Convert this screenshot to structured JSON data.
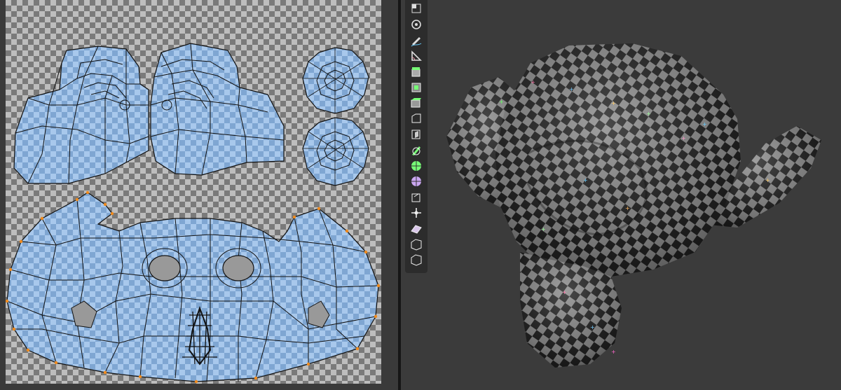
{
  "uv_editor": {
    "islands": [
      "head-left",
      "head-right",
      "ear-disc-top",
      "ear-disc-bottom",
      "face"
    ]
  },
  "viewport": {
    "object": "monkey-mesh",
    "material": "checker-texture"
  },
  "toolbar": {
    "tools": [
      {
        "name": "select-box-tool-icon",
        "active": false
      },
      {
        "name": "cursor-tool-icon",
        "active": false
      },
      {
        "name": "annotate-tool-icon",
        "active": false
      },
      {
        "name": "measure-tool-icon",
        "active": false
      },
      {
        "name": "add-cube-tool-icon",
        "active": false
      },
      {
        "name": "extrude-region-tool-icon",
        "active": false
      },
      {
        "name": "inset-faces-tool-icon",
        "active": false
      },
      {
        "name": "bevel-tool-icon",
        "active": false
      },
      {
        "name": "loop-cut-tool-icon",
        "active": false
      },
      {
        "name": "knife-tool-icon",
        "active": false
      },
      {
        "name": "poly-build-tool-icon",
        "active": false
      },
      {
        "name": "spin-tool-icon",
        "active": false
      },
      {
        "name": "smooth-tool-icon",
        "active": false
      },
      {
        "name": "edge-slide-tool-icon",
        "active": false
      },
      {
        "name": "shrink-fatten-tool-icon",
        "active": false
      },
      {
        "name": "shear-tool-icon",
        "active": false
      },
      {
        "name": "rip-region-tool-icon",
        "active": false
      }
    ],
    "active_color": "#4772b3"
  },
  "colors": {
    "island_fill": "#9ec3ea",
    "edge": "#111111",
    "boundary_vertex": "#f08a1c"
  }
}
